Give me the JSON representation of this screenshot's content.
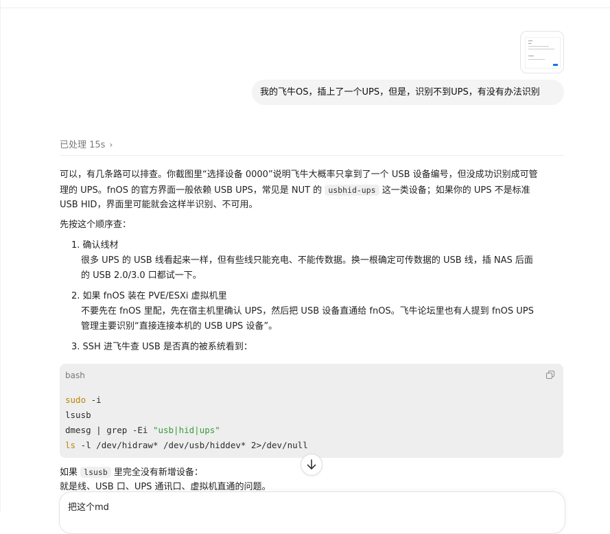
{
  "user_message": {
    "attachment_icon": "screenshot-thumbnail",
    "text": "我的飞牛OS，插上了一个UPS，但是，识别不到UPS，有没有办法识别"
  },
  "assistant": {
    "processed_label": "已处理 15s",
    "processed_icon": "chevron-right-icon",
    "intro": {
      "line1": "可以，有几条路可以排查。你截图里“选择设备 0000”说明飞牛大概率只拿到了一个 USB 设备编号，但没成功识别成可管",
      "line2_a": "理的 UPS。fnOS 的官方界面一般依赖 USB UPS，常见是 NUT 的",
      "line2_code": "usbhid-ups",
      "line2_b": "这一类设备；如果你的 UPS 不是标准",
      "line3": "USB HID，界面里可能就会这样半识别、不可用。"
    },
    "order_heading": "先按这个顺序查：",
    "steps": [
      {
        "title": "1. 确认线材",
        "body1": "很多 UPS 的 USB 线看起来一样，但有些线只能充电、不能传数据。换一根确定可传数据的 USB 线，插 NAS 后面",
        "body2": "的 USB 2.0/3.0 口都试一下。"
      },
      {
        "title": "2. 如果 fnOS 装在 PVE/ESXi 虚拟机里",
        "body1": "不要先在 fnOS 里配，先在宿主机里确认 UPS，然后把 USB 设备直通给 fnOS。飞牛论坛里也有人提到 fnOS UPS",
        "body2": "管理主要识别“直接连接本机的 USB UPS 设备”。"
      },
      {
        "title": "3. SSH 进飞牛查 USB 是否真的被系统看到："
      }
    ],
    "code": {
      "lang": "bash",
      "copy_icon": "copy-icon",
      "l1_kw": "sudo",
      "l1_rest": " -i",
      "l2": "lsusb",
      "l3_a": "dmesg | grep -Ei ",
      "l3_str": "\"usb|hid|ups\"",
      "l4_kw": "ls",
      "l4_rest": " -l /dev/hidraw* /dev/usb/hiddev* 2>/dev/null"
    },
    "after_a": "如果",
    "after_code": "lsusb",
    "after_b": "里完全没有新增设备：",
    "after_line2": "就是线、USB 口、UPS 通讯口、虚拟机直通的问题。"
  },
  "scroll_button_icon": "arrow-down-icon",
  "composer": {
    "value": "把这个md"
  }
}
